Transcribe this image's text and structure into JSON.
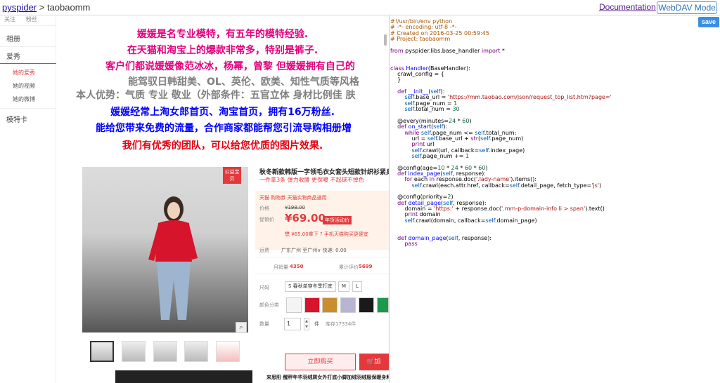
{
  "topbar": {
    "project_link": "pyspider",
    "separator": " > ",
    "project_name": "taobaomm",
    "doc_link": "Documentation",
    "webdav_button": "WebDAV Mode"
  },
  "editor": {
    "save_label": "save",
    "lines": [
      [
        {
          "t": "#!/usr/bin/env python",
          "c": "cm"
        }
      ],
      [
        {
          "t": "# -*- encoding: utf-8 -*-",
          "c": "cm"
        }
      ],
      [
        {
          "t": "# Created on 2016-03-25 00:59:45",
          "c": "cm"
        }
      ],
      [
        {
          "t": "# Project: taobaomm",
          "c": "cm"
        }
      ],
      [],
      [
        {
          "t": "from",
          "c": "kw"
        },
        {
          "t": " pyspider.libs.base_handler "
        },
        {
          "t": "import",
          "c": "kw"
        },
        {
          "t": " *"
        }
      ],
      [],
      [],
      [
        {
          "t": "class",
          "c": "kw"
        },
        {
          "t": " "
        },
        {
          "t": "Handler",
          "c": "df"
        },
        {
          "t": "(BaseHandler):"
        }
      ],
      [
        {
          "t": "    crawl_config = {"
        }
      ],
      [
        {
          "t": "    }"
        }
      ],
      [],
      [
        {
          "t": "    "
        },
        {
          "t": "def",
          "c": "kw"
        },
        {
          "t": " "
        },
        {
          "t": "__init__",
          "c": "df"
        },
        {
          "t": "("
        },
        {
          "t": "self",
          "c": "vb"
        },
        {
          "t": "):"
        }
      ],
      [
        {
          "t": "        "
        },
        {
          "t": "self",
          "c": "vb"
        },
        {
          "t": ".base_url = "
        },
        {
          "t": "'https://mm.taobao.com/json/request_top_list.htm?page='",
          "c": "st"
        }
      ],
      [
        {
          "t": "        "
        },
        {
          "t": "self",
          "c": "vb"
        },
        {
          "t": ".page_num = "
        },
        {
          "t": "1",
          "c": "nu"
        }
      ],
      [
        {
          "t": "        "
        },
        {
          "t": "self",
          "c": "vb"
        },
        {
          "t": ".total_num = "
        },
        {
          "t": "30",
          "c": "nu"
        }
      ],
      [],
      [
        {
          "t": "    @every(minutes="
        },
        {
          "t": "24",
          "c": "nu"
        },
        {
          "t": " * "
        },
        {
          "t": "60",
          "c": "nu"
        },
        {
          "t": ")"
        }
      ],
      [
        {
          "t": "    "
        },
        {
          "t": "def",
          "c": "kw"
        },
        {
          "t": " "
        },
        {
          "t": "on_start",
          "c": "df"
        },
        {
          "t": "("
        },
        {
          "t": "self",
          "c": "vb"
        },
        {
          "t": "):"
        }
      ],
      [
        {
          "t": "        "
        },
        {
          "t": "while",
          "c": "kw"
        },
        {
          "t": " "
        },
        {
          "t": "self",
          "c": "vb"
        },
        {
          "t": ".page_num <= "
        },
        {
          "t": "self",
          "c": "vb"
        },
        {
          "t": ".total_num:"
        }
      ],
      [
        {
          "t": "            url = "
        },
        {
          "t": "self",
          "c": "vb"
        },
        {
          "t": ".base_url + "
        },
        {
          "t": "str",
          "c": "kw"
        },
        {
          "t": "("
        },
        {
          "t": "self",
          "c": "vb"
        },
        {
          "t": ".page_num)"
        }
      ],
      [
        {
          "t": "            "
        },
        {
          "t": "print",
          "c": "kw"
        },
        {
          "t": " url"
        }
      ],
      [
        {
          "t": "            "
        },
        {
          "t": "self",
          "c": "vb"
        },
        {
          "t": ".crawl(url, callback="
        },
        {
          "t": "self",
          "c": "vb"
        },
        {
          "t": ".index_page)"
        }
      ],
      [
        {
          "t": "            "
        },
        {
          "t": "self",
          "c": "vb"
        },
        {
          "t": ".page_num += "
        },
        {
          "t": "1",
          "c": "nu"
        }
      ],
      [],
      [
        {
          "t": "    @config(age="
        },
        {
          "t": "10",
          "c": "nu"
        },
        {
          "t": " * "
        },
        {
          "t": "24",
          "c": "nu"
        },
        {
          "t": " * "
        },
        {
          "t": "60",
          "c": "nu"
        },
        {
          "t": " * "
        },
        {
          "t": "60",
          "c": "nu"
        },
        {
          "t": ")"
        }
      ],
      [
        {
          "t": "    "
        },
        {
          "t": "def",
          "c": "kw"
        },
        {
          "t": " "
        },
        {
          "t": "index_page",
          "c": "df"
        },
        {
          "t": "("
        },
        {
          "t": "self",
          "c": "vb"
        },
        {
          "t": ", response):"
        }
      ],
      [
        {
          "t": "        "
        },
        {
          "t": "for",
          "c": "kw"
        },
        {
          "t": " each "
        },
        {
          "t": "in",
          "c": "kw"
        },
        {
          "t": " response.doc("
        },
        {
          "t": "'.lady-name'",
          "c": "st"
        },
        {
          "t": ").items():"
        }
      ],
      [
        {
          "t": "            "
        },
        {
          "t": "self",
          "c": "vb"
        },
        {
          "t": ".crawl(each.attr.href, callback="
        },
        {
          "t": "self",
          "c": "vb"
        },
        {
          "t": ".detail_page, fetch_type="
        },
        {
          "t": "'js'",
          "c": "st"
        },
        {
          "t": ")"
        }
      ],
      [],
      [
        {
          "t": "    @config(priority="
        },
        {
          "t": "2",
          "c": "nu"
        },
        {
          "t": ")"
        }
      ],
      [
        {
          "t": "    "
        },
        {
          "t": "def",
          "c": "kw"
        },
        {
          "t": " "
        },
        {
          "t": "detail_page",
          "c": "df"
        },
        {
          "t": "("
        },
        {
          "t": "self",
          "c": "vb"
        },
        {
          "t": ", response):"
        }
      ],
      [
        {
          "t": "        domain = "
        },
        {
          "t": "'https:'",
          "c": "st"
        },
        {
          "t": " + response.doc("
        },
        {
          "t": "'.mm-p-domain-info li > span'",
          "c": "st"
        },
        {
          "t": ").text()"
        }
      ],
      [
        {
          "t": "        "
        },
        {
          "t": "print",
          "c": "kw"
        },
        {
          "t": " domain"
        }
      ],
      [
        {
          "t": "        "
        },
        {
          "t": "self",
          "c": "vb"
        },
        {
          "t": ".crawl(domain, callback="
        },
        {
          "t": "self",
          "c": "vb"
        },
        {
          "t": ".domain_page)"
        }
      ],
      [],
      [],
      [
        {
          "t": "    "
        },
        {
          "t": "def",
          "c": "kw"
        },
        {
          "t": " "
        },
        {
          "t": "domain_page",
          "c": "df"
        },
        {
          "t": "("
        },
        {
          "t": "self",
          "c": "vb"
        },
        {
          "t": ", response):"
        }
      ],
      [
        {
          "t": "        "
        },
        {
          "t": "pass",
          "c": "kw"
        }
      ]
    ]
  },
  "preview": {
    "sidebar": {
      "top_items": [
        "关注",
        "粉丝"
      ],
      "album": "相册",
      "hobby": "爱秀",
      "sub_items": [
        "她的爱秀",
        "她的视频",
        "她的微博"
      ],
      "model_card": "模特卡"
    },
    "intro": [
      {
        "text": "媛媛是名专业模特，有五年的模特经验.",
        "color": "#e4007f"
      },
      {
        "text": "在天猫和淘宝上的爆款非常多，特别是裤子.",
        "color": "#e4007f"
      },
      {
        "text": "客户们都说媛媛像范冰冰，杨幂，曾黎 但媛媛拥有自己的",
        "color": "#e4007f"
      },
      {
        "text": "能驾驭日韩甜美、OL、英伦、欧美、知性气质等风格",
        "color": "#7f7f7f"
      },
      {
        "text": "本人优势：气质 专业 敬业（外部条件：五官立体 身材比例佳 肤",
        "color": "#7f7f7f"
      },
      {
        "text": "媛媛经常上淘女郎首页、淘宝首页，拥有16万粉丝.",
        "color": "#0000ff"
      },
      {
        "text": "能给您带来免费的流量，合作商家都能帮您引流导购相册增",
        "color": "#0000ff"
      },
      {
        "text": "我们有优秀的团队，可以给您优质的图片效果.",
        "color": "#e60012"
      }
    ],
    "product": {
      "badge": "公益宝贝",
      "title": "秋冬新款韩版一字领毛衣女套头短款针织衫紧身",
      "subtitle": "一件拿3条 弹力收腰 更保暖 不起球不掉色",
      "tmall_tags": "天猫 购物券 天猫实物商品通用",
      "price_label": "价格",
      "original_price": "¥198.00",
      "promo_label": "促销价",
      "promo_price": "¥69.00",
      "promo_tag": "年货活动价",
      "coupon": "懋 ¥65.00拿下 ? 手机天猫购买更便宜",
      "shipping_label": "运费",
      "shipping": "广东广州 至广州∨ 快递: 0.00",
      "monthly_sales_label": "月销量",
      "monthly_sales": "4350",
      "reviews_label": "累计评价",
      "reviews": "5699",
      "size_label": "尺码",
      "sizes": [
        "S 春秋单穿冬季打底",
        "M",
        "L"
      ],
      "color_label": "颜色分类",
      "qty_label": "数量",
      "qty_value": "1",
      "qty_unit": "件",
      "stock": "库存17334件",
      "buy_now": "立即购买",
      "add_cart": "加",
      "bottom_text": "来思阳 醒秤年华羽绒屑女外打底小脚加绒羽绒服保暖身料"
    }
  }
}
